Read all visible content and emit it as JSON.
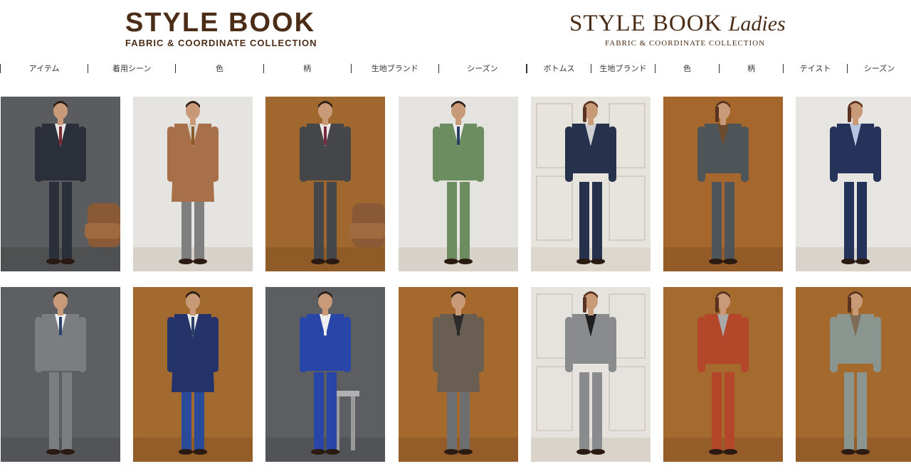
{
  "logos": {
    "men": {
      "title": "STYLE BOOK",
      "subtitle": "FABRIC & COORDINATE COLLECTION"
    },
    "ladies": {
      "title": "STYLE BOOK",
      "script": "Ladies",
      "subtitle": "FABRIC & COORDINATE COLLECTION"
    }
  },
  "nav_men": [
    "アイテム",
    "着用シーン",
    "色",
    "柄",
    "生地ブランド",
    "シーズン"
  ],
  "nav_ladies": [
    "ボトムス",
    "生地ブランド",
    "色",
    "柄",
    "テイスト",
    "シーズン"
  ],
  "photos": [
    {
      "bg": "#5b5c5f",
      "floor": "#4f5052",
      "suit": "#2b2f3a",
      "pants": "#2b2f3a",
      "shirt": "#e8e6e2",
      "tie": "#7a2a33",
      "gender": "m",
      "coat": false,
      "chair": true
    },
    {
      "bg": "#e6e4e0",
      "floor": "#d6d2ca",
      "suit": "#a8704a",
      "pants": "#7f7f80",
      "shirt": "#d8d4cc",
      "tie": "#8b5a2b",
      "gender": "m",
      "coat": true,
      "chair": false
    },
    {
      "bg": "#a0682e",
      "floor": "#8f5c28",
      "suit": "#44464a",
      "pants": "#44464a",
      "shirt": "#ece9e4",
      "tie": "#7a2a44",
      "gender": "m",
      "coat": false,
      "chair": true
    },
    {
      "bg": "#e5e3df",
      "floor": "#d8d3ca",
      "suit": "#6b8d5f",
      "pants": "#6b8d5f",
      "shirt": "#eeeeee",
      "tie": "#2a3f66",
      "gender": "m",
      "coat": false,
      "chair": false
    },
    {
      "bg": "#e7e4de",
      "floor": "#dcd6cc",
      "suit": "#26324b",
      "pants": "#26324b",
      "shirt": "#cfcfd2",
      "tie": "#8a8a8a",
      "gender": "f",
      "coat": false,
      "chair": false
    },
    {
      "bg": "#a5672c",
      "floor": "#935b27",
      "suit": "#4d5559",
      "pants": "#4d5559",
      "shirt": "#6c4a2e",
      "tie": "#6c4a2e",
      "gender": "f",
      "coat": false,
      "chair": false
    },
    {
      "bg": "#e7e5e1",
      "floor": "#d9d4cb",
      "suit": "#25325a",
      "pants": "#25325a",
      "shirt": "#b7c5e2",
      "tie": "#2f2f6f",
      "gender": "f",
      "coat": false,
      "chair": false
    },
    {
      "bg": "#5d5f62",
      "floor": "#525457",
      "suit": "#7b7d80",
      "pants": "#7b7d80",
      "shirt": "#eeeeee",
      "tie": "#2a3f66",
      "gender": "m",
      "coat": false,
      "chair": false
    },
    {
      "bg": "#a36a2f",
      "floor": "#925d29",
      "suit": "#24336a",
      "pants": "#2a4a9a",
      "shirt": "#e9e9e9",
      "tie": "#2a3f66",
      "gender": "m",
      "coat": true,
      "chair": false
    },
    {
      "bg": "#5c5e61",
      "floor": "#515356",
      "suit": "#2746a8",
      "pants": "#2746a8",
      "shirt": "#eeeeee",
      "tie": "#eeeeee",
      "gender": "m",
      "coat": false,
      "chair": false,
      "seated": true
    },
    {
      "bg": "#a5692e",
      "floor": "#935c28",
      "suit": "#6a5e52",
      "pants": "#6d6e70",
      "shirt": "#2b2b2b",
      "tie": "#2b2b2b",
      "gender": "m",
      "coat": true,
      "chair": false
    },
    {
      "bg": "#e6e3de",
      "floor": "#d9d3ca",
      "suit": "#8a8b8d",
      "pants": "#8a8b8d",
      "shirt": "#1f1f1f",
      "tie": "#1f1f1f",
      "gender": "f",
      "coat": false,
      "chair": false
    },
    {
      "bg": "#a56a2e",
      "floor": "#945d29",
      "suit": "#b4472a",
      "pants": "#b4472a",
      "shirt": "#a9a9a9",
      "tie": "#a9a9a9",
      "gender": "f",
      "coat": false,
      "chair": false
    },
    {
      "bg": "#a4692d",
      "floor": "#935c28",
      "suit": "#8b958f",
      "pants": "#8b958f",
      "shirt": "#7d6b55",
      "tie": "#7d6b55",
      "gender": "f",
      "coat": false,
      "chair": false
    }
  ]
}
